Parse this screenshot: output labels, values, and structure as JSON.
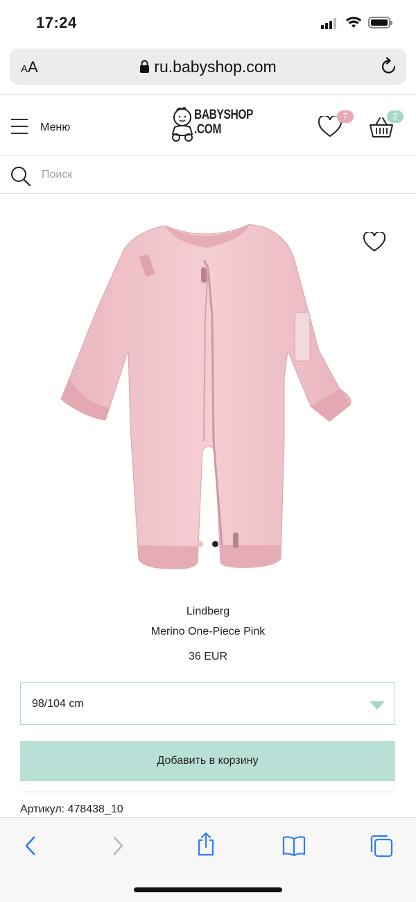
{
  "status": {
    "time": "17:24"
  },
  "browser": {
    "aa_label": "AA",
    "url": "ru.babyshop.com"
  },
  "header": {
    "menu_label": "Меню",
    "logo_text": "BABYSHOP .COM",
    "wishlist_count": "7",
    "cart_count": "2"
  },
  "search": {
    "placeholder": "Поиск"
  },
  "product": {
    "brand": "Lindberg",
    "name": "Merino One-Piece Pink",
    "price": "36 EUR",
    "image_count": 2,
    "active_image": 2,
    "size_selected": "98/104 cm",
    "add_to_cart_label": "Добавить в корзину",
    "sku_label": "Артикул: 478438_10"
  },
  "colors": {
    "accent": "#b9e0d6",
    "select_border": "#a5d6ca",
    "wish_badge": "#e8a9b4",
    "cart_badge": "#a6d8cc",
    "product_pink": "#f2c6cc",
    "ios_blue": "#2f7cf6"
  }
}
